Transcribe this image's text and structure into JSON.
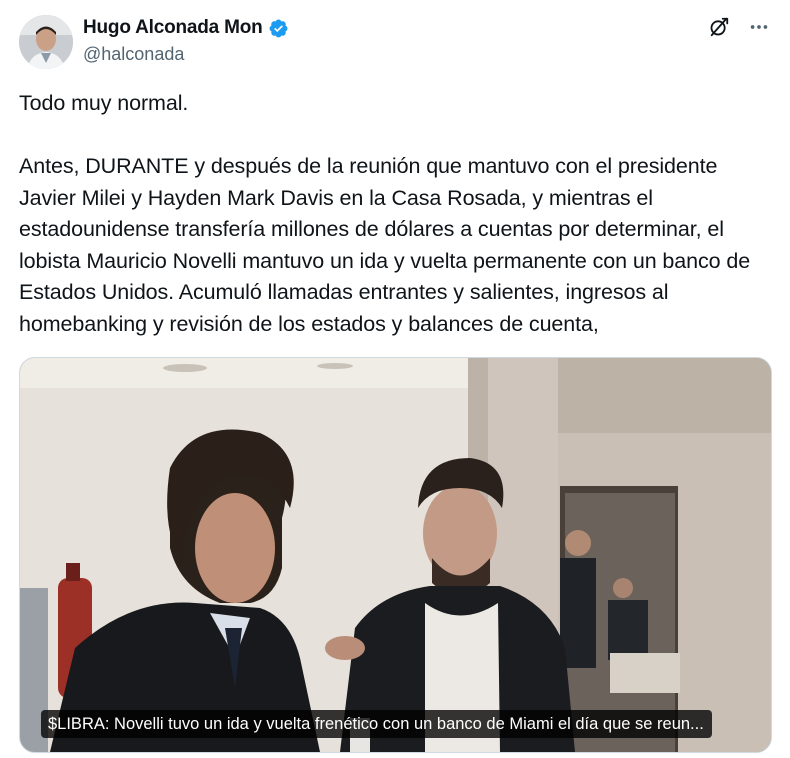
{
  "author": {
    "display_name": "Hugo Alconada Mon",
    "handle": "@halconada",
    "verified": true,
    "verified_color": "#1d9bf0"
  },
  "header_icons": [
    "grok-icon",
    "more-icon"
  ],
  "tweet": {
    "text": "Todo muy normal.\n\nAntes, DURANTE y después de la reunión que mantuvo con el presidente Javier Milei y Hayden Mark Davis en la Casa Rosada, y mientras el estadounidense transfería millones de dólares a cuentas por determinar, el lobista Mauricio Novelli mantuvo un ida y vuelta permanente con un banco de Estados Unidos. Acumuló llamadas entrantes y salientes, ingresos al homebanking y revisión de los estados y balances de cuenta,"
  },
  "media": {
    "caption": "$LIBRA: Novelli tuvo un ida y vuelta frenético con un banco de Miami el día que se reun..."
  }
}
